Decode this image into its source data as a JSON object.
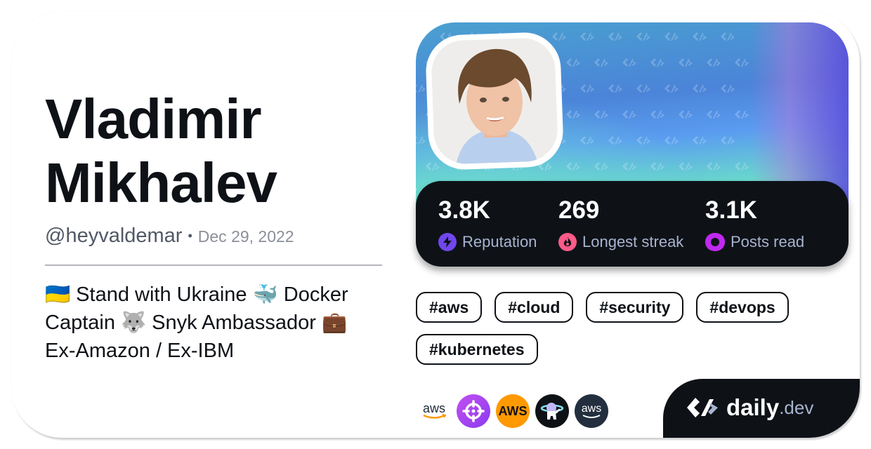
{
  "profile": {
    "name": "Vladimir Mikhalev",
    "handle": "@heyvaldemar",
    "separator": "•",
    "joined": "Dec 29, 2022",
    "bio": "🇺🇦 Stand with Ukraine 🐳 Docker Captain 🐺 Snyk Ambassador 💼 Ex-Amazon / Ex-IBM"
  },
  "stats": [
    {
      "value": "3.8K",
      "label": "Reputation",
      "icon": "lightning-icon",
      "color": "#7147ed"
    },
    {
      "value": "269",
      "label": "Longest streak",
      "icon": "flame-icon",
      "color": "#ff5b89"
    },
    {
      "value": "3.1K",
      "label": "Posts read",
      "icon": "eye-icon",
      "color": "#c029f0"
    }
  ],
  "tags": [
    "#aws",
    "#cloud",
    "#security",
    "#devops",
    "#kubernetes"
  ],
  "squads": [
    {
      "name": "aws-wordmark",
      "bg": "#ffffff",
      "text": "aws"
    },
    {
      "name": "crosshair-squad",
      "bg": "#a848f0",
      "text": ""
    },
    {
      "name": "aws-orange",
      "bg": "#ff9900",
      "text": "AWS"
    },
    {
      "name": "astronaut-squad",
      "bg": "#0e1217",
      "text": ""
    },
    {
      "name": "aws-dark",
      "bg": "#232f3e",
      "text": "aws"
    }
  ],
  "brand": {
    "word1": "daily",
    "word2": ".dev",
    "dark": "#0e1217"
  }
}
